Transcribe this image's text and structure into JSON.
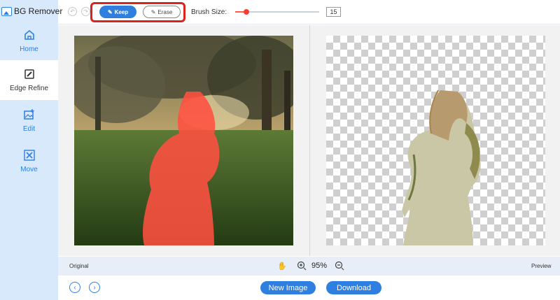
{
  "app": {
    "title": "BG Remover"
  },
  "sidebar": {
    "items": [
      {
        "label": "Home",
        "icon": "home-icon"
      },
      {
        "label": "Edge Refine",
        "icon": "brush-icon"
      },
      {
        "label": "Edit",
        "icon": "image-edit-icon"
      },
      {
        "label": "Move",
        "icon": "move-icon"
      }
    ],
    "active": "Edge Refine"
  },
  "toolbar": {
    "keep_label": "Keep",
    "erase_label": "Erase",
    "brush_label": "Brush Size:",
    "brush_size": "15",
    "brush_level": 0.13
  },
  "canvas": {
    "original_label": "Original",
    "preview_label": "Preview",
    "zoom": "95%"
  },
  "footer": {
    "new_image_label": "New Image",
    "download_label": "Download"
  },
  "colors": {
    "accent": "#2f7fe0",
    "highlight_box": "#d9241c",
    "keep_mask": "#ff5040"
  }
}
